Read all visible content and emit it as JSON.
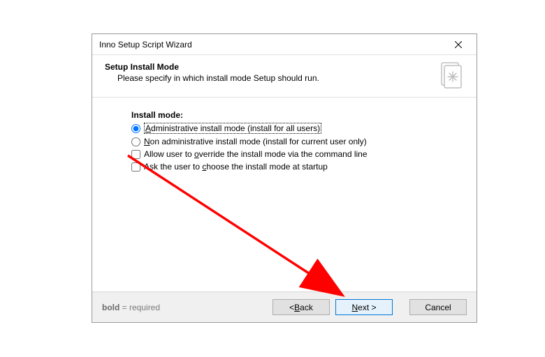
{
  "window": {
    "title": "Inno Setup Script Wizard"
  },
  "header": {
    "title": "Setup Install Mode",
    "subtitle": "Please specify in which install mode Setup should run."
  },
  "section": {
    "label": "Install mode:"
  },
  "options": {
    "radio1": {
      "prefix": "",
      "accel": "A",
      "rest": "dministrative install mode (install for all users)",
      "checked": true
    },
    "radio2": {
      "prefix": "",
      "accel": "N",
      "rest": "on administrative install mode (install for current user only)",
      "checked": false
    },
    "check1": {
      "prefix": "Allow user to ",
      "accel": "o",
      "rest": "verride the install mode via the command line",
      "checked": false
    },
    "check2": {
      "prefix": "Ask the user to ",
      "accel": "c",
      "rest": "hoose the install mode at startup",
      "checked": false
    }
  },
  "footer": {
    "hint_bold": "bold",
    "hint_rest": " = required",
    "back": {
      "prefix": "< ",
      "accel": "B",
      "rest": "ack"
    },
    "next": {
      "prefix": "",
      "accel": "N",
      "rest": "ext >"
    },
    "cancel": "Cancel"
  }
}
